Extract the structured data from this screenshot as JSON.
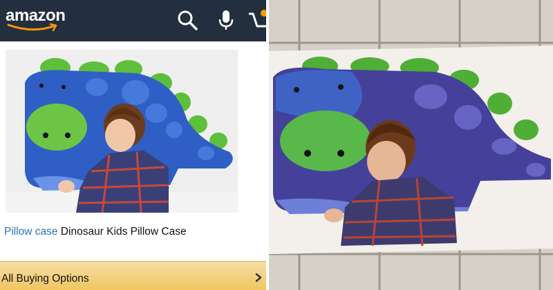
{
  "header": {
    "logo_text": "amazon",
    "icons": [
      "search-icon",
      "microphone-icon",
      "cart-icon"
    ]
  },
  "product": {
    "title_link": "Pillow case",
    "title_rest": " Dinosaur Kids Pillow Case",
    "image_subject": "dinosaur-pillow-with-sleeping-boy"
  },
  "buy_bar": {
    "label": "All Buying Options",
    "icon": "chevron-right-icon"
  },
  "comparison_photo": {
    "subject": "received-flat-pillowcase-print-on-tile-floor"
  },
  "colors": {
    "header_bg": "#232f3e",
    "link": "#2a73b5",
    "buy_bar": "#f0c55f",
    "dino_blue": "#2f5fc4",
    "dino_green": "#5ebf3c"
  }
}
